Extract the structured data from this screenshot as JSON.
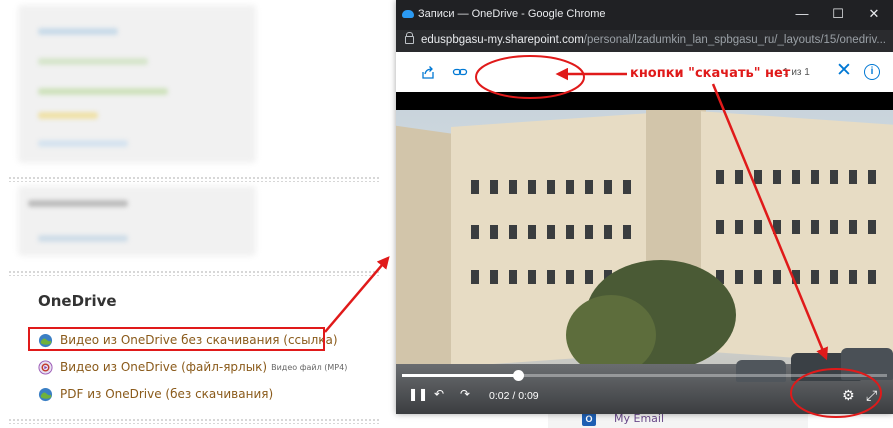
{
  "left_page": {
    "section_title": "OneDrive",
    "resources": [
      {
        "label": "Видео из OneDrive без скачивания (ссылка)",
        "sub": ""
      },
      {
        "label": "Видео из OneDrive (файл-ярлык)",
        "sub": "Видео файл (MP4)"
      },
      {
        "label": "PDF из OneDrive (без скачивания)",
        "sub": ""
      }
    ],
    "bottom_peek": {
      "icon_letter": "O",
      "label": "My Email"
    }
  },
  "browser": {
    "window_title": "Записи — OneDrive - Google Chrome",
    "url_host": "eduspbgasu-my.sharepoint.com",
    "url_path": "/personal/lzadumkin_lan_spbgasu_ru/_layouts/15/onedriv...",
    "controls": {
      "minimize": "—",
      "maximize": "☐",
      "close": "✕"
    }
  },
  "viewer": {
    "counter": "1 из 1",
    "icons": [
      "share-icon",
      "link-icon",
      "close-icon",
      "info-icon"
    ]
  },
  "video": {
    "current_time": "0:02",
    "duration": "0:09",
    "time_display": "0:02 / 0:09",
    "progress": 0.24
  },
  "annotation": {
    "text": "кнопки \"скачать\" нет",
    "color": "#e01a1a"
  },
  "colors": {
    "accent": "#0078d4",
    "link": "#8a5a1a",
    "annotation": "#e01a1a"
  }
}
